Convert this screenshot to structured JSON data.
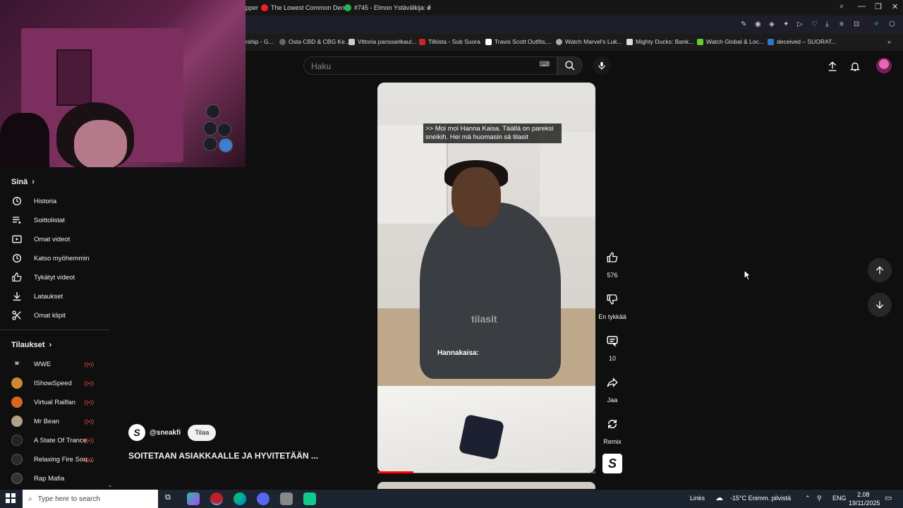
{
  "browser": {
    "tabs": [
      {
        "label": "pper"
      },
      {
        "label": "The Lowest Common Den"
      },
      {
        "label": "#745 - Elmon Ystävälkija: J"
      },
      {
        "label": "+"
      }
    ],
    "bookmarks": [
      "rship - G...",
      "Osta CBD & CBG Ke...",
      "Vittoria panssarikaul...",
      "Tilkista - Sub Suora",
      "Travis Scott Outfits,...",
      "Watch Marvel's Luk...",
      "Mighty Ducks: Bank...",
      "Watch Global & Loc...",
      "deceived – SUORAT..."
    ]
  },
  "header": {
    "search_placeholder": "Haku"
  },
  "sidebar": {
    "you_title": "Sinä",
    "you_items": [
      {
        "label": "Historia",
        "icon": "history-icon"
      },
      {
        "label": "Soittolistat",
        "icon": "playlist-icon"
      },
      {
        "label": "Omat videot",
        "icon": "video-icon"
      },
      {
        "label": "Katso myöhemmin",
        "icon": "clock-icon"
      },
      {
        "label": "Tykätyt videot",
        "icon": "thumb-up-icon"
      },
      {
        "label": "Lataukset",
        "icon": "download-icon"
      },
      {
        "label": "Omat klipit",
        "icon": "scissors-icon"
      }
    ],
    "subs_title": "Tilaukset",
    "subscriptions": [
      {
        "label": "WWE",
        "color": "#111111"
      },
      {
        "label": "IShowSpeed",
        "color": "#c98a3a"
      },
      {
        "label": "Virtual Railfan",
        "color": "#d9661e"
      },
      {
        "label": "Mr Bean",
        "color": "#b0a08a"
      },
      {
        "label": "A State Of Trance",
        "color": "#222222"
      },
      {
        "label": "Relaxing Fire Sou...",
        "color": "#2a2a2a"
      },
      {
        "label": "Rap Mafia",
        "color": "#333333"
      }
    ]
  },
  "short": {
    "caption_top": ">> Moi moi Hanna Kaisa. Täällä on pareksi sneikih. Hei mä huomasin sä tilasit",
    "caption_mid": "tilasit",
    "caption_bottom": "Hannakaisa:",
    "progress": 0.16,
    "channel_logo": "S",
    "channel_handle": "@sneakfi",
    "subscribe_label": "Tilaa",
    "title": "SOITETAAN ASIAKKAALLE JA HYVITETÄÄN ..."
  },
  "actions": {
    "likes": "576",
    "dislike_label": "En tykkää",
    "comments": "10",
    "share_label": "Jaa",
    "remix_label": "Remix"
  },
  "taskbar": {
    "search_placeholder": "Type here to search",
    "links_label": "Links",
    "weather": "-15°C  Enimm. pilvistä",
    "language": "ENG",
    "time": "2.08",
    "date": "19/11/2025"
  }
}
